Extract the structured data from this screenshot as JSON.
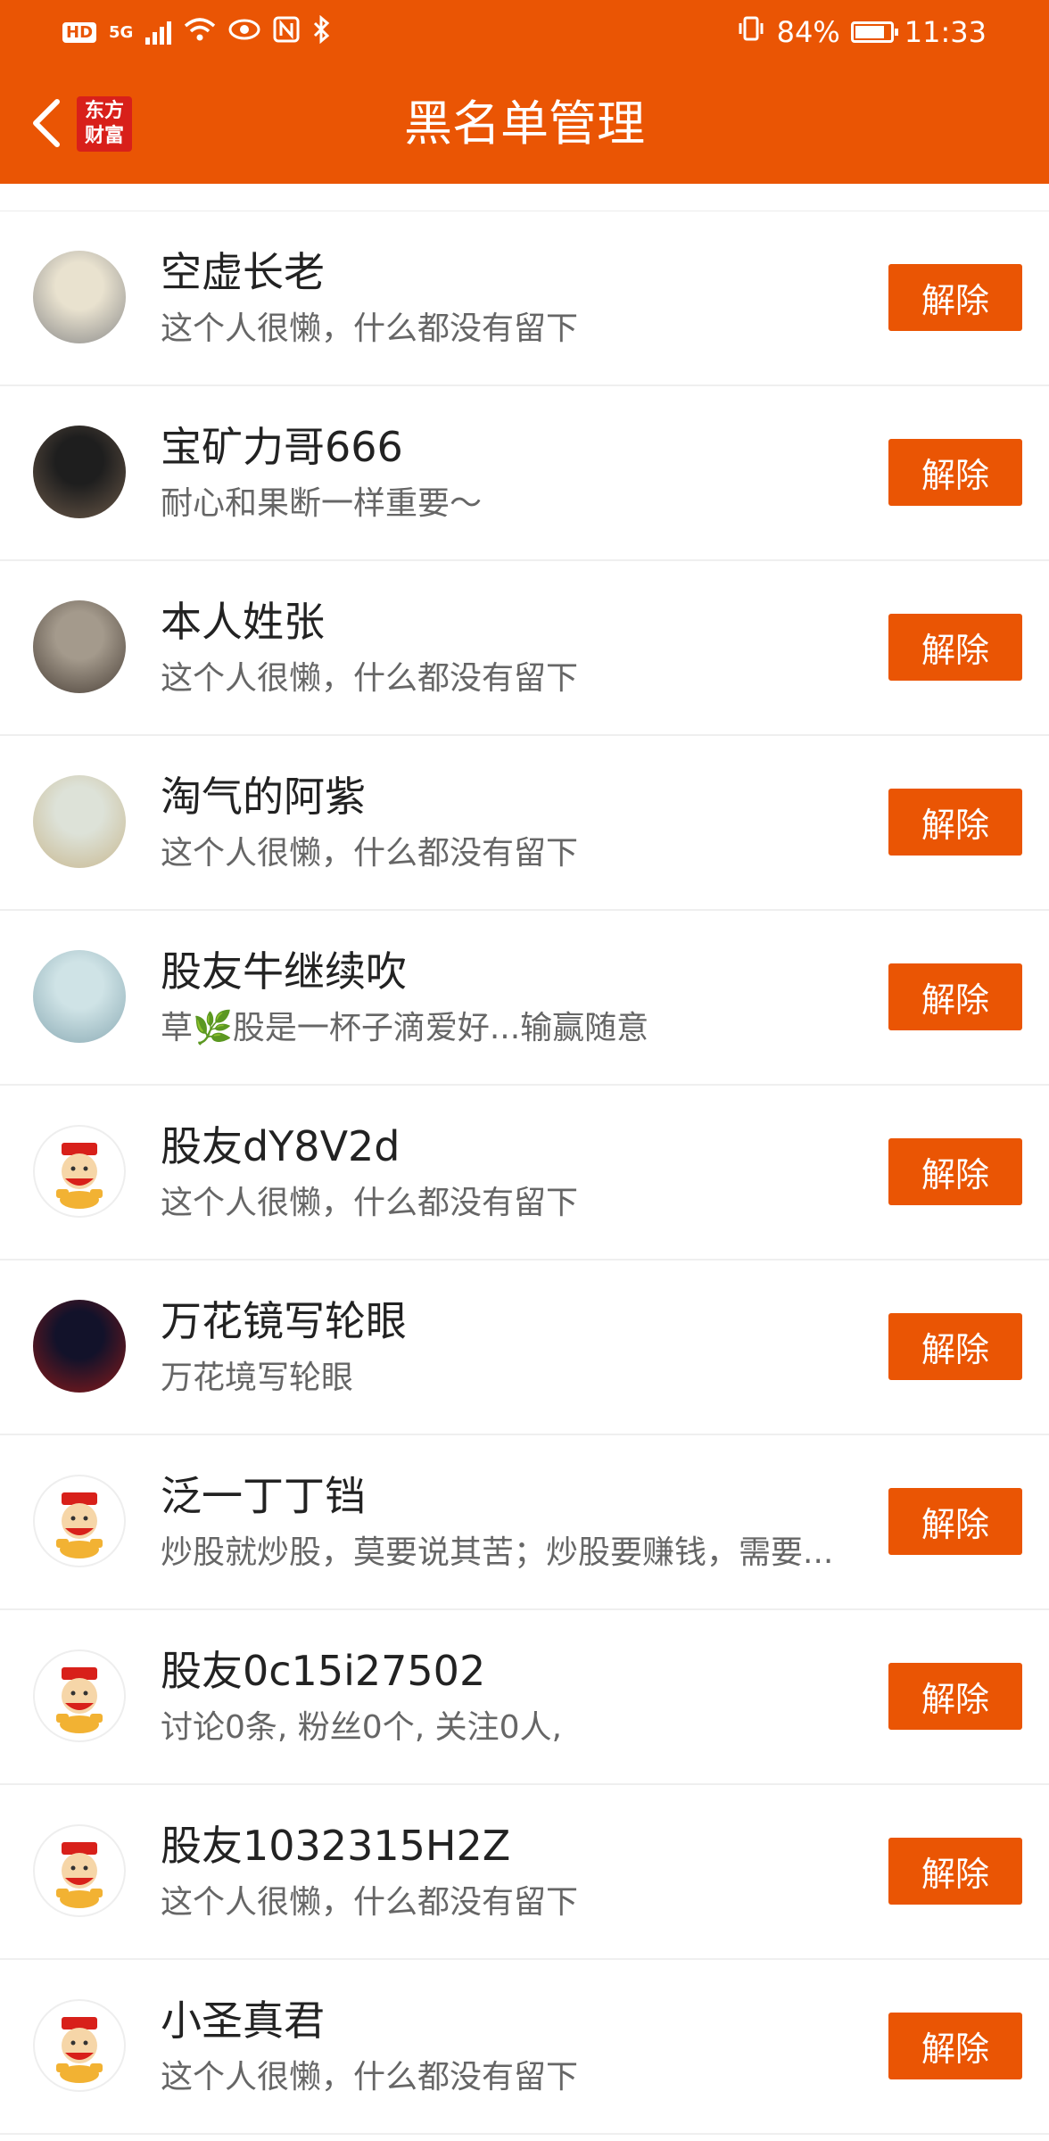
{
  "status_bar": {
    "hd": "HD",
    "net": "5G",
    "battery_percent": "84%",
    "time": "11:33",
    "battery_level": 0.84
  },
  "nav": {
    "logo_line1": "东方",
    "logo_line2": "财富",
    "title": "黑名单管理"
  },
  "unblock_label": "解除",
  "users": [
    {
      "name": "空虚长老",
      "desc": "这个人很懒，什么都没有留下",
      "avatar": "photo-avatar",
      "colors": [
        "#e9e2cf",
        "#8a8a8a"
      ]
    },
    {
      "name": "宝矿力哥666",
      "desc": "耐心和果断一样重要～",
      "avatar": "photo-avatar",
      "colors": [
        "#1e1e1e",
        "#6a5848"
      ]
    },
    {
      "name": "本人姓张",
      "desc": "这个人很懒，什么都没有留下",
      "avatar": "photo-avatar",
      "colors": [
        "#a49a8c",
        "#4a4038"
      ]
    },
    {
      "name": "淘气的阿紫",
      "desc": "这个人很懒，什么都没有留下",
      "avatar": "photo-avatar",
      "colors": [
        "#dde2d8",
        "#c8b890"
      ]
    },
    {
      "name": "股友牛继续吹",
      "desc": "草🌿股是一杯子滴爱好...输赢随意",
      "avatar": "photo-avatar",
      "colors": [
        "#cfe3e6",
        "#8aaab4"
      ]
    },
    {
      "name": "股友dY8V2d",
      "desc": "这个人很懒，什么都没有留下",
      "avatar": "default-avatar",
      "colors": [
        "#fff3e0",
        "#d8201a"
      ]
    },
    {
      "name": "万花镜写轮眼",
      "desc": "万花境写轮眼",
      "avatar": "photo-avatar",
      "colors": [
        "#12122a",
        "#8a1a1a"
      ]
    },
    {
      "name": "泛一丁丁铛",
      "desc": "炒股就炒股，莫要说其苦；炒股要赚钱，需要...",
      "avatar": "default-avatar",
      "colors": [
        "#fff3e0",
        "#d8201a"
      ]
    },
    {
      "name": "股友0c15i27502",
      "desc": "讨论0条, 粉丝0个, 关注0人,",
      "avatar": "default-avatar",
      "colors": [
        "#fff3e0",
        "#d8201a"
      ]
    },
    {
      "name": "股友1032315H2Z",
      "desc": "这个人很懒，什么都没有留下",
      "avatar": "default-avatar",
      "colors": [
        "#fff3e0",
        "#d8201a"
      ]
    },
    {
      "name": "小圣真君",
      "desc": "这个人很懒，什么都没有留下",
      "avatar": "default-avatar",
      "colors": [
        "#fff3e0",
        "#d8201a"
      ]
    }
  ],
  "colors": {
    "accent": "#ea5504",
    "logo": "#d8201a"
  }
}
